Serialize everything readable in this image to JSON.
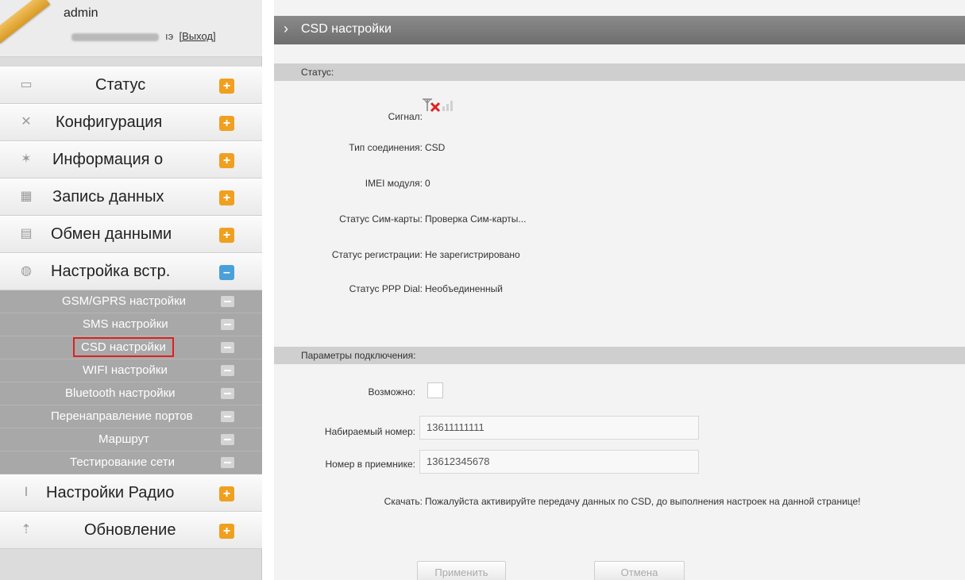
{
  "user": {
    "badge": "",
    "name": "admin",
    "logout_label": "[Выход]",
    "suffix": "ıэ"
  },
  "menu": [
    {
      "label": "Статус",
      "icon": "monitor-icon"
    },
    {
      "label": "Конфигурация",
      "icon": "tools-icon"
    },
    {
      "label": "Информация о",
      "icon": "satellite-icon"
    },
    {
      "label": "Запись данных",
      "icon": "calendar-icon"
    },
    {
      "label": "Обмен данными",
      "icon": "network-icon"
    },
    {
      "label": "Настройка встр.",
      "icon": "globe-icon"
    }
  ],
  "submenu": [
    {
      "label": "GSM/GPRS настройки"
    },
    {
      "label": "SMS настройки"
    },
    {
      "label": "CSD настройки"
    },
    {
      "label": "WIFI настройки"
    },
    {
      "label": "Bluetooth настройки"
    },
    {
      "label": "Перенаправление портов"
    },
    {
      "label": "Маршрут"
    },
    {
      "label": "Тестирование сети"
    }
  ],
  "menu_bottom": [
    {
      "label": "Настройки Радио",
      "icon": "antenna-icon"
    },
    {
      "label": "Обновление",
      "icon": "upload-icon"
    }
  ],
  "page": {
    "title": "CSD настройки"
  },
  "status_section": {
    "title": "Статус:",
    "signal_label": "Сигнал:",
    "conn_type_label": "Тип соединения:",
    "conn_type_value": "CSD",
    "imei_label": "IMEI модуля:",
    "imei_value": "0",
    "sim_label": "Статус Сим-карты:",
    "sim_value": "Проверка Сим-карты...",
    "reg_label": "Статус регистрации:",
    "reg_value": "Не зарегистрировано",
    "ppp_label": "Статус PPP Dial:",
    "ppp_value": "Необъединенный"
  },
  "conn_section": {
    "title": "Параметры подключения:",
    "enable_label": "Возможно:",
    "dial_label": "Набираемый номер:",
    "dial_value": "13611111111",
    "receiver_label": "Номер в приемнике:",
    "receiver_value": "13612345678",
    "download_label": "Скачать:",
    "download_value": "Пожалуйста активируйте передачу данных по CSD, до выполнения настроек на данной странице!"
  },
  "buttons": {
    "apply": "Применить",
    "cancel": "Отмена"
  },
  "colors": {
    "accent_orange": "#f0a020",
    "title_bar": "#7a7a7a",
    "submenu_bg": "#a8a8a8",
    "highlight_red": "#e02020"
  }
}
